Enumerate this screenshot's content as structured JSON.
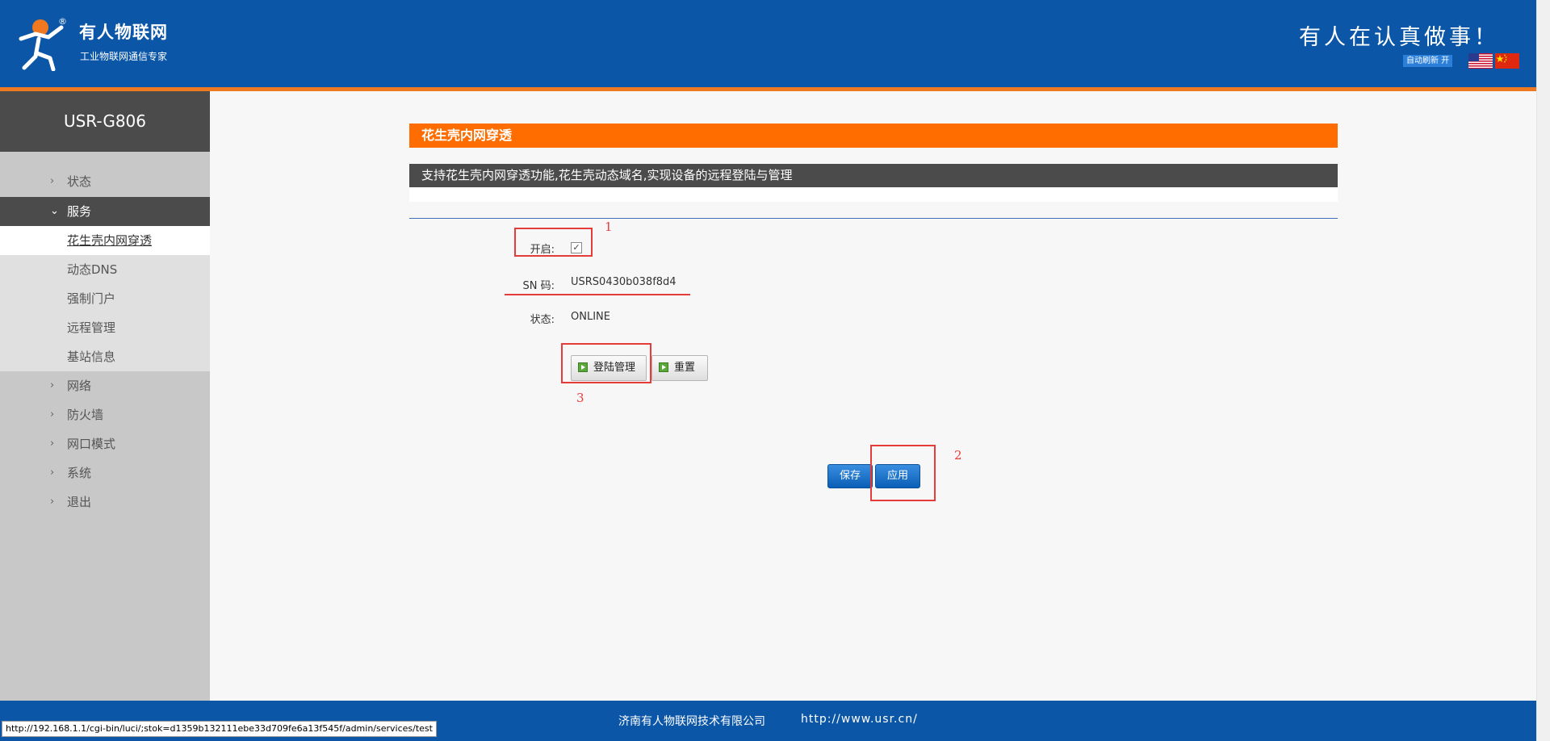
{
  "header": {
    "brand_name": "有人物联网",
    "brand_sub": "工业物联网通信专家",
    "slogan": "有人在认真做事！",
    "auto_refresh": "自动刷新 开",
    "logo_trademark": "®"
  },
  "sidebar": {
    "device": "USR-G806",
    "items": [
      {
        "label": "状态",
        "chevron": "chevron-right"
      },
      {
        "label": "服务",
        "chevron": "chevron-down"
      },
      {
        "label": "网络",
        "chevron": "chevron-right"
      },
      {
        "label": "防火墙",
        "chevron": "chevron-right"
      },
      {
        "label": "网口模式",
        "chevron": "chevron-right"
      },
      {
        "label": "系统",
        "chevron": "chevron-right"
      },
      {
        "label": "退出",
        "chevron": "chevron-right"
      }
    ],
    "subitems": [
      "花生壳内网穿透",
      "动态DNS",
      "强制门户",
      "远程管理",
      "基站信息"
    ],
    "active_subitem": "花生壳内网穿透"
  },
  "main": {
    "title": "花生壳内网穿透",
    "description": "支持花生壳内网穿透功能,花生壳动态域名,实现设备的远程登陆与管理",
    "enable_label": "开启:",
    "enable_checked": true,
    "sn_label": "SN 码:",
    "sn_value": "USRS0430b038f8d4",
    "status_label": "状态:",
    "status_value": "ONLINE",
    "login_button": "登陆管理",
    "reset_button": "重置",
    "save_button": "保存",
    "apply_button": "应用"
  },
  "annotations": [
    "1",
    "2",
    "3"
  ],
  "footer": {
    "company": "济南有人物联网技术有限公司",
    "url": "http://www.usr.cn/"
  },
  "status_bar": {
    "link_url": "http://192.168.1.1/cgi-bin/luci/;stok=d1359b132111ebe33d709fe6a13f545f/admin/services/test"
  },
  "colors": {
    "header_blue": "#0b56a7",
    "accent_orange": "#ff6c00",
    "annotation_red": "#e53b3b",
    "sidebar_dark": "#4b4b4b"
  }
}
